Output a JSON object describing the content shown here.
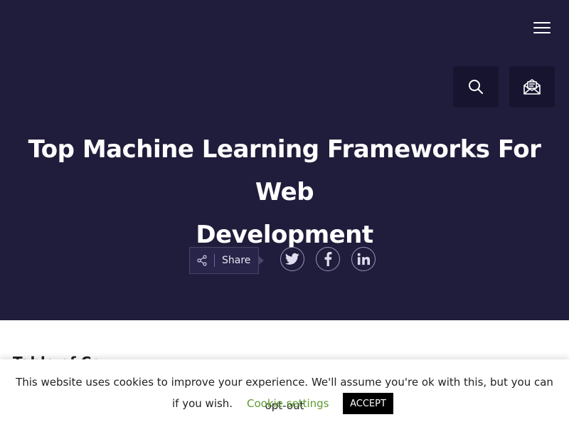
{
  "header": {
    "menu_icon": "hamburger-menu-icon",
    "search_icon": "search-icon",
    "subscribe_icon": "envelope-newsletter-icon"
  },
  "article": {
    "title_line1": "Top Machine Learning Frameworks For Web",
    "title_line2": "Development",
    "toc_partial": "Table of Co"
  },
  "share": {
    "label": "Share",
    "icon": "share-icon",
    "social": [
      "twitter-icon",
      "facebook-icon",
      "linkedin-icon"
    ]
  },
  "cookie": {
    "message": "This website uses cookies to improve your experience. We'll assume you're ok with this, but you can opt-out",
    "message_tail": "if you wish.",
    "settings_label": "Cookie settings",
    "accept_label": "ACCEPT"
  },
  "colors": {
    "hero_bg": "#201c3b",
    "button_bg": "#171430",
    "accent_green": "#5c9b2f"
  }
}
